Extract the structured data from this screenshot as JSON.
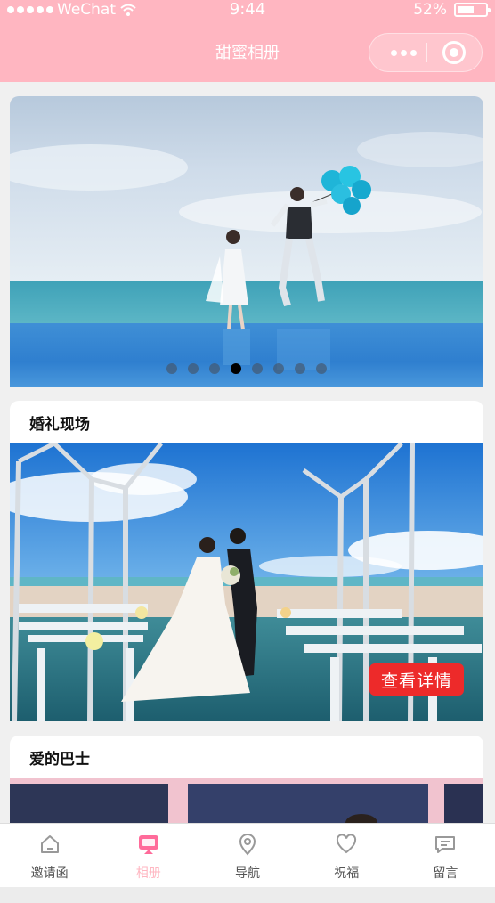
{
  "status_bar": {
    "carrier": "WeChat",
    "time": "9:44",
    "battery": "52%",
    "battery_level": 0.52
  },
  "nav": {
    "title": "甜蜜相册"
  },
  "carousel": {
    "page_count": 8,
    "active_index": 3
  },
  "sections": [
    {
      "title": "婚礼现场",
      "button_label": "查看详情"
    },
    {
      "title": "爱的巴士"
    }
  ],
  "tabbar": {
    "active_index": 1,
    "active_color": "#ff6b9a",
    "inactive_color": "#999999",
    "items": [
      {
        "label": "邀请函",
        "icon": "home-icon"
      },
      {
        "label": "相册",
        "icon": "album-icon"
      },
      {
        "label": "导航",
        "icon": "location-pin-icon"
      },
      {
        "label": "祝福",
        "icon": "heart-icon"
      },
      {
        "label": "留言",
        "icon": "message-icon"
      }
    ]
  },
  "colors": {
    "header_pink": "#ffb6c1",
    "button_red": "#ed2a2a"
  }
}
